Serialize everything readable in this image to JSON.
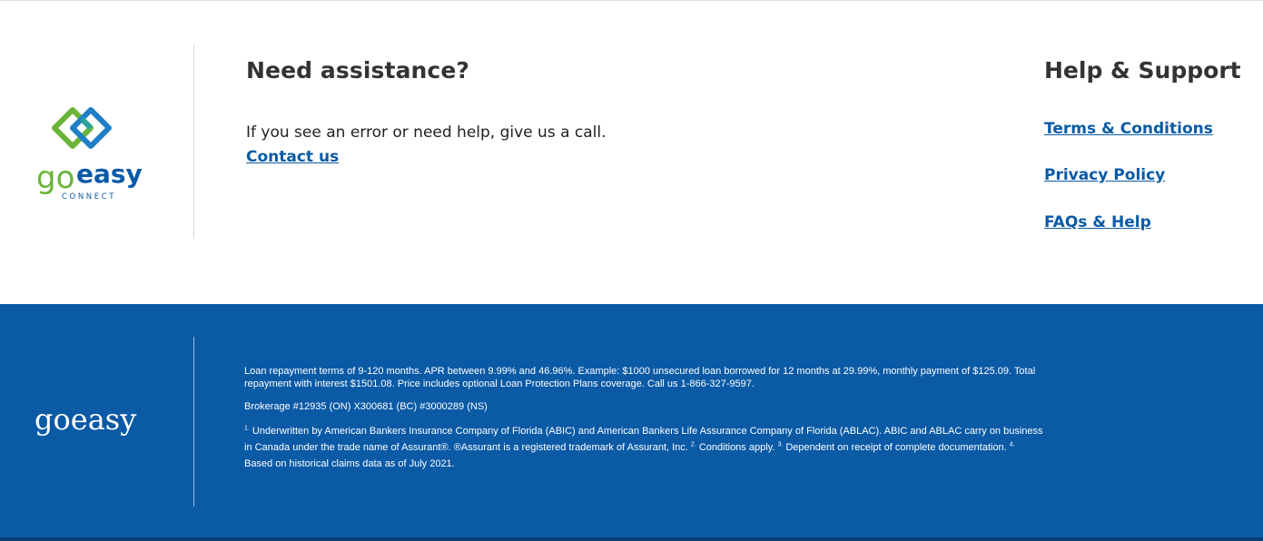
{
  "brand": {
    "logo_word_go": "go",
    "logo_word_easy": "easy",
    "logo_sub": "CONNECT",
    "footer_logo_text": "goeasy",
    "colors": {
      "primary_blue": "#0a5aa6",
      "green": "#6ab539",
      "teal": "#2aa3a0",
      "heading": "#333333"
    }
  },
  "assistance": {
    "title": "Need assistance?",
    "text": "If you see an error or need help, give us a call.",
    "contact_link": "Contact us"
  },
  "help_support": {
    "title": "Help & Support",
    "links": [
      {
        "label": "Terms & Conditions"
      },
      {
        "label": "Privacy Policy"
      },
      {
        "label": "FAQs & Help"
      }
    ]
  },
  "footer": {
    "loan_terms": "Loan repayment terms of 9-120 months. APR between 9.99% and 46.96%. Example: $1000 unsecured loan borrowed for 12 months at 29.99%, monthly payment of $125.09. Total repayment with interest $1501.08. Price includes optional Loan Protection Plans coverage. Call us 1-866-327-9597.",
    "brokerage": "Brokerage #12935 (ON) X300681 (BC) #3000289 (NS)",
    "notes": [
      {
        "marker": "1.",
        "text": " Underwritten by American Bankers Insurance Company of Florida (ABIC) and American Bankers Life Assurance Company of Florida (ABLAC). ABIC and ABLAC carry on business in Canada under the trade name of Assurant®. ®Assurant is a registered trademark of Assurant, Inc. "
      },
      {
        "marker": "2.",
        "text": " Conditions apply. "
      },
      {
        "marker": "3.",
        "text": " Dependent on receipt of complete documentation. "
      },
      {
        "marker": "4.",
        "text": " Based on historical claims data as of July 2021."
      }
    ]
  }
}
